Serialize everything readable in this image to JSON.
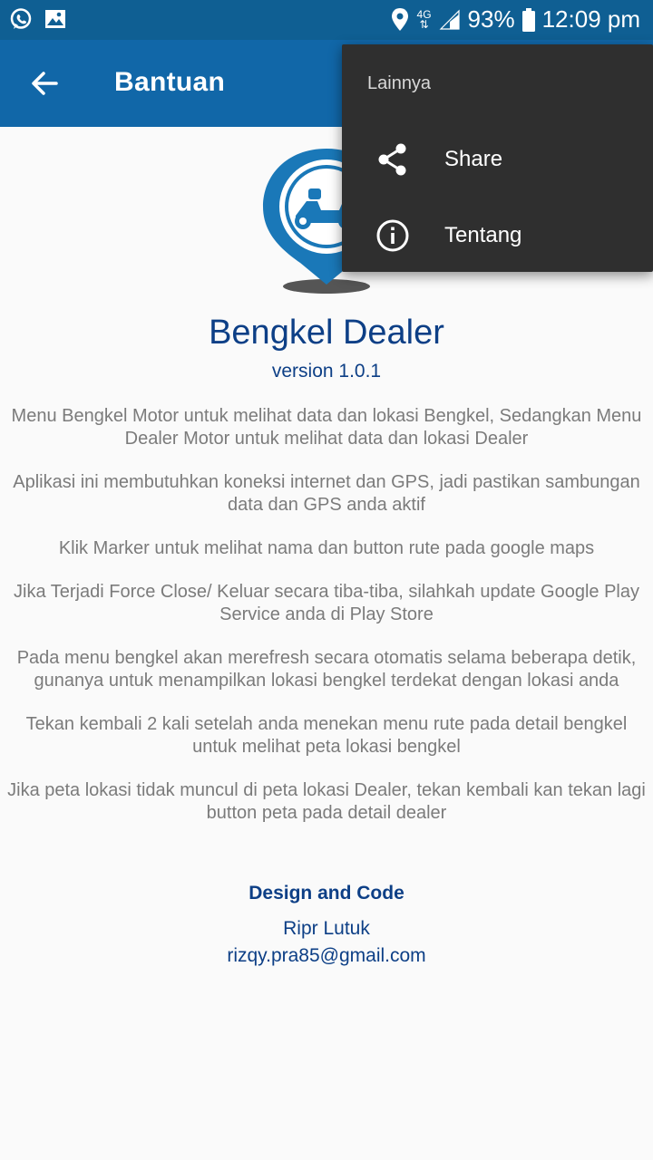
{
  "status_bar": {
    "network_label": "4G",
    "battery": "93%",
    "time": "12:09 pm",
    "icons": [
      "whatsapp-icon",
      "gallery-icon",
      "location-icon",
      "signal-icon",
      "battery-icon"
    ]
  },
  "app_bar": {
    "title": "Bantuan",
    "back_icon": "arrow-back-icon",
    "color": "#1167a8"
  },
  "overflow_menu": {
    "header": "Lainnya",
    "items": [
      {
        "label": "Share",
        "icon": "share-icon"
      },
      {
        "label": "Tentang",
        "icon": "info-icon"
      }
    ]
  },
  "about": {
    "logo_icon": "scooter-location-pin-icon",
    "app_name": "Bengkel Dealer",
    "version": "version 1.0.1",
    "paragraphs": [
      "Menu Bengkel Motor untuk melihat data dan lokasi Bengkel, Sedangkan Menu Dealer Motor untuk melihat data dan lokasi Dealer",
      "Aplikasi ini membutuhkan koneksi internet dan GPS, jadi pastikan sambungan data dan GPS anda aktif",
      "Klik Marker untuk melihat nama dan button rute pada google maps",
      "Jika Terjadi Force Close/ Keluar secara tiba-tiba, silahkah update Google Play Service anda di Play Store",
      "Pada menu bengkel akan merefresh secara otomatis selama beberapa detik, gunanya untuk menampilkan lokasi bengkel terdekat dengan lokasi anda",
      "Tekan kembali 2 kali setelah anda menekan menu rute pada detail bengkel untuk melihat peta lokasi bengkel",
      "Jika peta lokasi tidak muncul di peta lokasi Dealer, tekan kembali kan tekan lagi button peta pada detail dealer"
    ],
    "credits_heading": "Design and Code",
    "author": "Ripr Lutuk",
    "email": "rizqy.pra85@gmail.com"
  },
  "colors": {
    "status_bar": "#0f5f93",
    "accent_text": "#0d3f86",
    "body_text": "#7b7b7b",
    "menu_background": "#2f2f2f"
  }
}
